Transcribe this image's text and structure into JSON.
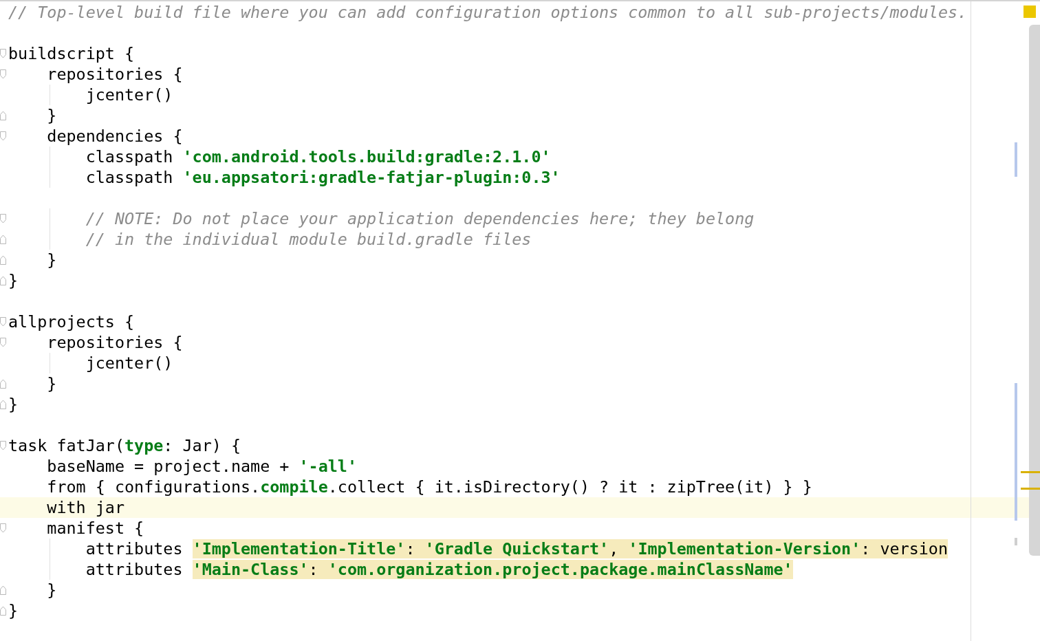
{
  "editor": {
    "lines": [
      {
        "current": false,
        "tokens": [
          {
            "text": "// Top-level build file where you can add configuration options common to all sub-projects/modules.",
            "kind": "comment",
            "warn": false
          }
        ]
      },
      {
        "current": false
      },
      {
        "current": false,
        "fold": {
          "kind": "start"
        },
        "tokens": [
          {
            "text": "buildscript {",
            "kind": "plain",
            "warn": false
          }
        ]
      },
      {
        "current": false,
        "fold": {
          "kind": "start"
        },
        "tokens": [
          {
            "text": "    repositories {",
            "kind": "plain",
            "warn": false
          }
        ]
      },
      {
        "current": false,
        "tokens": [
          {
            "text": "        jcenter()",
            "kind": "plain",
            "warn": false
          }
        ]
      },
      {
        "current": false,
        "fold": {
          "kind": "end"
        },
        "tokens": [
          {
            "text": "    }",
            "kind": "plain",
            "warn": false
          }
        ]
      },
      {
        "current": false,
        "fold": {
          "kind": "start"
        },
        "tokens": [
          {
            "text": "    dependencies {",
            "kind": "plain",
            "warn": false
          }
        ]
      },
      {
        "current": false,
        "tokens": [
          {
            "text": "        classpath ",
            "kind": "plain",
            "warn": false
          },
          {
            "text": "'com.android.tools.build:gradle:2.1.0'",
            "kind": "string",
            "warn": false
          }
        ]
      },
      {
        "current": false,
        "tokens": [
          {
            "text": "        classpath ",
            "kind": "plain",
            "warn": false
          },
          {
            "text": "'eu.appsatori:gradle-fatjar-plugin:0.3'",
            "kind": "string",
            "warn": false
          }
        ]
      },
      {
        "current": false
      },
      {
        "current": false,
        "fold": {
          "kind": "start"
        },
        "tokens": [
          {
            "text": "        // NOTE: Do not place your application dependencies here; they belong",
            "kind": "comment",
            "warn": false
          }
        ]
      },
      {
        "current": false,
        "fold": {
          "kind": "end"
        },
        "tokens": [
          {
            "text": "        // in the individual module build.gradle files",
            "kind": "comment",
            "warn": false
          }
        ]
      },
      {
        "current": false,
        "fold": {
          "kind": "end"
        },
        "tokens": [
          {
            "text": "    }",
            "kind": "plain",
            "warn": false
          }
        ]
      },
      {
        "current": false,
        "fold": {
          "kind": "end"
        },
        "tokens": [
          {
            "text": "}",
            "kind": "plain",
            "warn": false
          }
        ]
      },
      {
        "current": false
      },
      {
        "current": false,
        "fold": {
          "kind": "start"
        },
        "tokens": [
          {
            "text": "allprojects {",
            "kind": "plain",
            "warn": false
          }
        ]
      },
      {
        "current": false,
        "fold": {
          "kind": "start"
        },
        "tokens": [
          {
            "text": "    repositories {",
            "kind": "plain",
            "warn": false
          }
        ]
      },
      {
        "current": false,
        "tokens": [
          {
            "text": "        jcenter()",
            "kind": "plain",
            "warn": false
          }
        ]
      },
      {
        "current": false,
        "fold": {
          "kind": "end"
        },
        "tokens": [
          {
            "text": "    }",
            "kind": "plain",
            "warn": false
          }
        ]
      },
      {
        "current": false,
        "fold": {
          "kind": "end"
        },
        "tokens": [
          {
            "text": "}",
            "kind": "plain",
            "warn": false
          }
        ]
      },
      {
        "current": false
      },
      {
        "current": false,
        "fold": {
          "kind": "start"
        },
        "tokens": [
          {
            "text": "task fatJar(",
            "kind": "plain",
            "warn": false
          },
          {
            "text": "type",
            "kind": "keyword",
            "warn": false
          },
          {
            "text": ": Jar) {",
            "kind": "plain",
            "warn": false
          }
        ]
      },
      {
        "current": false,
        "tokens": [
          {
            "text": "    baseName = project.name + ",
            "kind": "plain",
            "warn": false
          },
          {
            "text": "'-all'",
            "kind": "string",
            "warn": false
          }
        ]
      },
      {
        "current": false,
        "tokens": [
          {
            "text": "    from { configurations.",
            "kind": "plain",
            "warn": false
          },
          {
            "text": "compile",
            "kind": "keyword",
            "warn": false
          },
          {
            "text": ".collect { it.isDirectory() ? it : zipTree(it) } }",
            "kind": "plain",
            "warn": false
          }
        ]
      },
      {
        "current": true,
        "tokens": [
          {
            "text": "    with jar",
            "kind": "plain",
            "warn": false
          }
        ]
      },
      {
        "current": false,
        "fold": {
          "kind": "start"
        },
        "tokens": [
          {
            "text": "    manifest {",
            "kind": "plain",
            "warn": false
          }
        ]
      },
      {
        "current": false,
        "tokens": [
          {
            "text": "        attributes ",
            "kind": "plain",
            "warn": false
          },
          {
            "text": "'Implementation-Title'",
            "kind": "string",
            "warn": true
          },
          {
            "text": ": ",
            "kind": "plain",
            "warn": true
          },
          {
            "text": "'Gradle Quickstart'",
            "kind": "string",
            "warn": true
          },
          {
            "text": ", ",
            "kind": "plain",
            "warn": true
          },
          {
            "text": "'Implementation-Version'",
            "kind": "string",
            "warn": true
          },
          {
            "text": ": version",
            "kind": "plain",
            "warn": true
          }
        ]
      },
      {
        "current": false,
        "tokens": [
          {
            "text": "        attributes ",
            "kind": "plain",
            "warn": false
          },
          {
            "text": "'Main-Class'",
            "kind": "string",
            "warn": true
          },
          {
            "text": ": ",
            "kind": "plain",
            "warn": true
          },
          {
            "text": "'com.organization.project.package.mainClassName'",
            "kind": "string",
            "warn": true
          }
        ]
      },
      {
        "current": false,
        "fold": {
          "kind": "end"
        },
        "tokens": [
          {
            "text": "    }",
            "kind": "plain",
            "warn": false
          }
        ]
      },
      {
        "current": false,
        "fold": {
          "kind": "end"
        },
        "tokens": [
          {
            "text": "}",
            "kind": "plain",
            "warn": false
          }
        ]
      }
    ]
  }
}
